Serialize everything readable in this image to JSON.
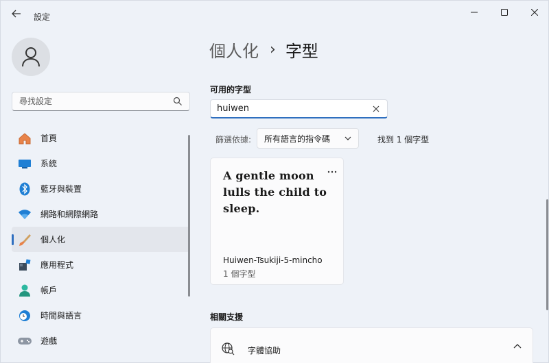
{
  "app": {
    "title": "設定"
  },
  "search": {
    "placeholder": "尋找設定"
  },
  "sidebar": {
    "items": [
      {
        "label": "首頁",
        "icon": "home-icon"
      },
      {
        "label": "系統",
        "icon": "monitor-icon"
      },
      {
        "label": "藍牙與裝置",
        "icon": "bluetooth-icon"
      },
      {
        "label": "網路和網際網路",
        "icon": "wifi-icon"
      },
      {
        "label": "個人化",
        "icon": "brush-icon",
        "active": true
      },
      {
        "label": "應用程式",
        "icon": "apps-icon"
      },
      {
        "label": "帳戶",
        "icon": "account-icon"
      },
      {
        "label": "時間與語言",
        "icon": "clock-globe-icon"
      },
      {
        "label": "遊戲",
        "icon": "gamepad-icon"
      }
    ]
  },
  "breadcrumb": {
    "parent": "個人化",
    "separator": "›",
    "current": "字型"
  },
  "available_fonts": {
    "section_label": "可用的字型",
    "search_value": "huiwen",
    "filter_label": "篩選依據:",
    "filter_value": "所有語言的指令碼",
    "found_text": "找到 1 個字型"
  },
  "font_card": {
    "preview_text": "A gentle moon lulls the child to sleep.",
    "name": "Huiwen-Tsukiji-5-mincho",
    "count": "1 個字型"
  },
  "related": {
    "section_label": "相關支援",
    "item_label": "字體協助"
  },
  "colors": {
    "accent": "#2f6fbf",
    "background": "#eef2f8"
  }
}
